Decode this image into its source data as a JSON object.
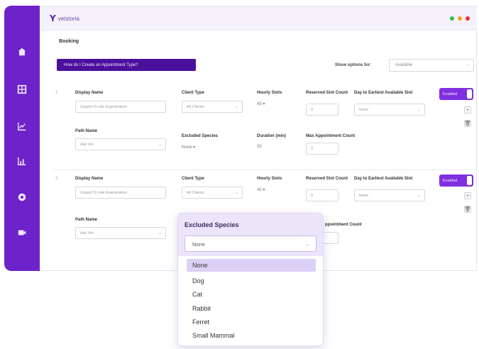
{
  "window": {
    "dots": [
      "#2bc24a",
      "#f4a11b",
      "#e8322e"
    ]
  },
  "logo": {
    "mark": "Y",
    "text": "vetstoria"
  },
  "page": {
    "title": "Booking"
  },
  "toolbar": {
    "how_to": "How do I Create an Appointment Type?",
    "show_options_label": "Show options for:",
    "show_options_value": "Available"
  },
  "rows": [
    {
      "num": "1",
      "display_name_label": "Display Name",
      "display_name_placeholder": "Urgent Or site Examination",
      "client_type_label": "Client Type",
      "client_type_value": "All Clients",
      "hourly_slots_label": "Hourly Slots",
      "hourly_slots_value": "All ▾",
      "reserved_label": "Reserved Slot Count",
      "reserved_value": "0",
      "days_label": "Day to Earliest Available Slot",
      "days_value": "None",
      "enabled_label": "Enabled",
      "path_name_label": "Path Name",
      "path_name_value": "Ask Vet",
      "excluded_label": "Excluded Species",
      "excluded_value": "None ▾",
      "duration_label": "Duration (min)",
      "duration_value": "30",
      "max_label": "Max Appointment Count",
      "max_value": "0"
    },
    {
      "num": "2",
      "display_name_label": "Display Name",
      "display_name_placeholder": "Urgent Or site Examination",
      "client_type_label": "Client Type",
      "client_type_value": "All Clients",
      "hourly_slots_label": "Hourly Slots",
      "hourly_slots_value": "All ▾",
      "reserved_label": "Reserved Slot Count",
      "reserved_value": "0",
      "days_label": "Day to Earliest Available Slot",
      "days_value": "None",
      "enabled_label": "Enabled",
      "path_name_label": "Path Name",
      "path_name_value": "Ask Vet",
      "max_label_partial": "ppointment Count",
      "max_value": "0"
    }
  ],
  "dropdown": {
    "title": "Excluded Species",
    "selected": "None",
    "options": [
      "None",
      "Dog",
      "Cat",
      "Rabbit",
      "Ferret",
      "Small Mammal"
    ]
  },
  "side_buttons": {
    "add": "+",
    "delete": "🗑"
  },
  "sidebar_icons": [
    "home-icon",
    "grid-icon",
    "chart-line-icon",
    "chart-bar-icon",
    "settings-icon",
    "video-icon"
  ]
}
